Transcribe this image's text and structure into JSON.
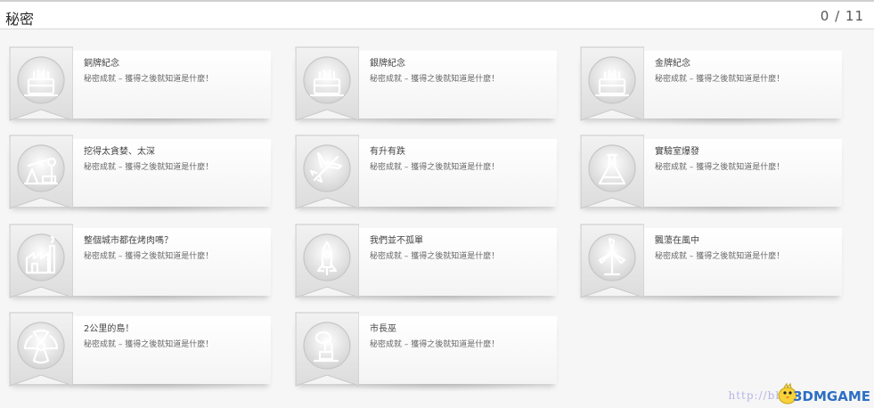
{
  "header": {
    "title": "秘密",
    "counter": "0 / 11"
  },
  "achievements": [
    {
      "name": "銅牌紀念",
      "description": "秘密成就 – 獲得之後就知道是什麼！",
      "icon": "cake-icon"
    },
    {
      "name": "銀牌紀念",
      "description": "秘密成就 – 獲得之後就知道是什麼！",
      "icon": "cake-icon"
    },
    {
      "name": "金牌紀念",
      "description": "秘密成就 – 獲得之後就知道是什麼！",
      "icon": "cake-icon"
    },
    {
      "name": "挖得太貪婪、太深",
      "description": "秘密成就 – 獲得之後就知道是什麼！",
      "icon": "oil-pump-icon"
    },
    {
      "name": "有升有跌",
      "description": "秘密成就 – 獲得之後就知道是什麼！",
      "icon": "airplane-icon"
    },
    {
      "name": "實驗室爆發",
      "description": "秘密成就 – 獲得之後就知道是什麼！",
      "icon": "flask-icon"
    },
    {
      "name": "整個城市都在烤肉嗎？",
      "description": "秘密成就 – 獲得之後就知道是什麼！",
      "icon": "factory-icon"
    },
    {
      "name": "我們並不孤單",
      "description": "秘密成就 – 獲得之後就知道是什麼！",
      "icon": "rocket-icon"
    },
    {
      "name": "飄蕩在風中",
      "description": "秘密成就 – 獲得之後就知道是什麼！",
      "icon": "wind-turbine-icon"
    },
    {
      "name": "2公里的島！",
      "description": "秘密成就 – 獲得之後就知道是什麼！",
      "icon": "radiation-icon"
    },
    {
      "name": "市長巫",
      "description": "秘密成就 – 獲得之後就知道是什麼！",
      "icon": "statue-icon"
    }
  ],
  "watermark": {
    "url": "http://bbs.",
    "brand": "3DMGAME"
  }
}
